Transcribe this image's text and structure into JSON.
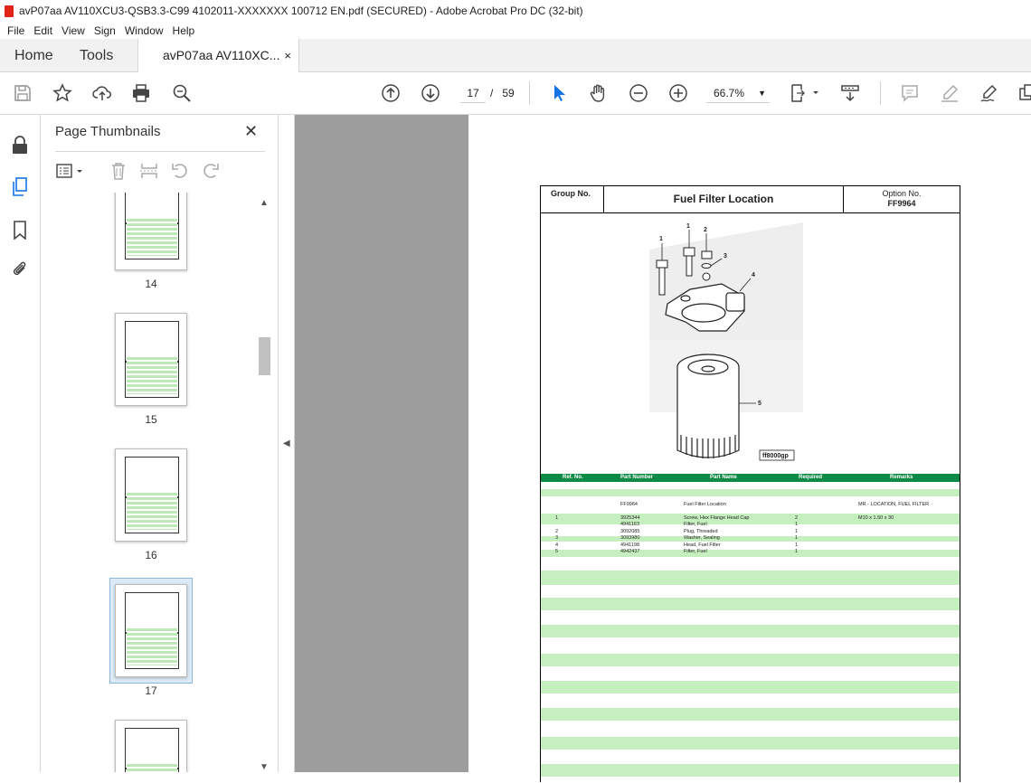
{
  "window": {
    "title": "avP07aa AV110XCU3-QSB3.3-C99 4102011-XXXXXXX 100712 EN.pdf (SECURED) - Adobe Acrobat Pro DC (32-bit)"
  },
  "menu": [
    "File",
    "Edit",
    "View",
    "Sign",
    "Window",
    "Help"
  ],
  "tabs": {
    "home": "Home",
    "tools": "Tools",
    "doc": "avP07aa AV110XC...",
    "doc_close": "×"
  },
  "toolbar": {
    "page_current": "17",
    "page_separator": "/",
    "page_total": "59",
    "zoom": "66.7%"
  },
  "icons": [
    "save-icon",
    "star-icon",
    "upload-icon",
    "print-icon",
    "zoom-search-icon",
    "page-up-icon",
    "page-down-icon",
    "select-cursor-icon",
    "hand-icon",
    "zoom-out-icon",
    "zoom-in-icon",
    "fit-page-icon",
    "scroll-mode-icon",
    "comment-icon",
    "highlight-icon",
    "sign-icon",
    "more-icon"
  ],
  "accent_color": "#1473e6",
  "panel": {
    "title": "Page Thumbnails",
    "close": "✕"
  },
  "thumbnails": [
    {
      "label": "14"
    },
    {
      "label": "15"
    },
    {
      "label": "16"
    },
    {
      "label": "17",
      "selected": true
    },
    {
      "label": ""
    }
  ],
  "document": {
    "group_label": "Group No.",
    "title": "Fuel Filter Location",
    "option_label": "Option No.",
    "option_value": "FF9964",
    "figure_code": "ff8000gp",
    "callouts": [
      "1",
      "1",
      "2",
      "3",
      "4",
      "5"
    ],
    "table_color": "#0d8a45",
    "columns": [
      "Ref. No.",
      "Part Number",
      "Part Name",
      "Required",
      "Remarks"
    ],
    "rows": [
      {
        "ref": "",
        "part": "FF9964",
        "name": "Fuel Filter Location",
        "req": "",
        "remarks": "MR - LOCATION, FUEL FILTER"
      },
      {
        "ref": "1",
        "part": "3925344",
        "name": "Screw, Hex Flange Head Cap",
        "req": "2",
        "remarks": "M10 x 1.50 x 30"
      },
      {
        "ref": "",
        "part": "4941163",
        "name": "Filter, Fuel",
        "req": "1",
        "remarks": ""
      },
      {
        "ref": "2",
        "part": "3092085",
        "name": "Plug, Threaded",
        "req": "1",
        "remarks": ""
      },
      {
        "ref": "3",
        "part": "3093980",
        "name": "Washer, Sealing",
        "req": "1",
        "remarks": ""
      },
      {
        "ref": "4",
        "part": "4941198",
        "name": "Head, Fuel Filter",
        "req": "1",
        "remarks": ""
      },
      {
        "ref": "5",
        "part": "4942437",
        "name": "Filter, Fuel",
        "req": "1",
        "remarks": ""
      }
    ]
  }
}
